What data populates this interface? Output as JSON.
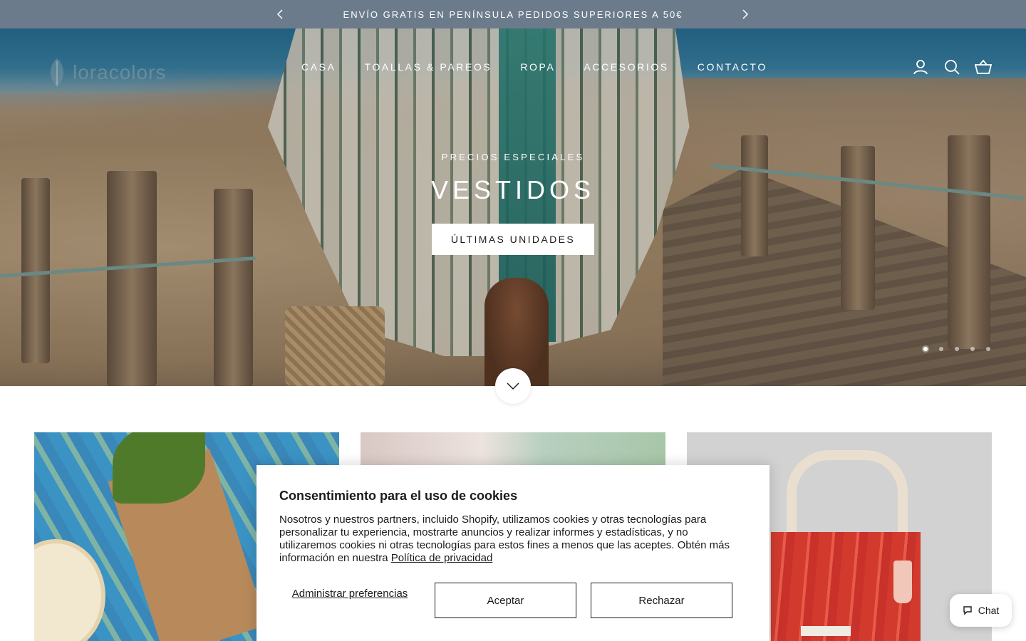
{
  "announcement": {
    "text": "ENVÍO GRATIS EN PENÍNSULA PEDIDOS SUPERIORES A 50€",
    "prev_icon": "chevron-left-icon",
    "next_icon": "chevron-right-icon"
  },
  "header": {
    "logo_text": "loracolors",
    "nav": [
      "CASA",
      "TOALLAS & PAREOS",
      "ROPA",
      "ACCESORIOS",
      "CONTACTO"
    ],
    "icons": [
      "account-icon",
      "search-icon",
      "cart-icon"
    ]
  },
  "hero": {
    "subtitle": "PRECIOS ESPECIALES",
    "title": "VESTIDOS",
    "button_label": "ÚLTIMAS UNIDADES",
    "slide_count": 5,
    "active_slide": 1,
    "scroll_icon": "chevron-down-icon"
  },
  "cookie_banner": {
    "title": "Consentimiento para el uso de cookies",
    "body": "Nosotros y nuestros partners, incluido Shopify, utilizamos cookies y otras tecnologías para personalizar tu experiencia, mostrarte anuncios y realizar informes y estadísticas, y no utilizaremos cookies ni otras tecnologías para estos fines a menos que las aceptes. Obtén más información en nuestra",
    "link_text": "Política de privacidad",
    "manage_label": "Administrar preferencias",
    "accept_label": "Aceptar",
    "reject_label": "Rechazar"
  },
  "chat": {
    "label": "Chat",
    "icon": "chat-bubble-icon"
  },
  "colors": {
    "announcement_bg": "#6b7b8c",
    "text_dark": "#1c1b1b",
    "white": "#ffffff"
  }
}
